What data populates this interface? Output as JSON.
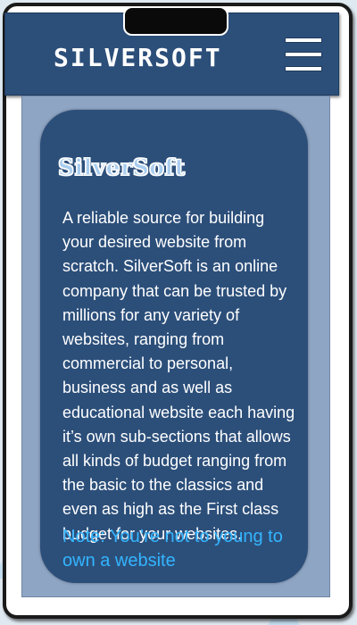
{
  "header": {
    "brand": "SILVERSOFT",
    "menu_icon": "hamburger-menu-icon"
  },
  "card": {
    "title": "SilverSoft",
    "body": "A reliable source for building your desired website from scratch. SilverSoft is an online company that can be trusted by millions for any variety of websites, ranging from commercial to personal, business and as well as educational website each having it’s own sub-sections that allows all kinds of budget ranging from the basic to the classics and even as high as the First class budget for your websites.",
    "note": "Note: You’re not to young to own a website"
  },
  "colors": {
    "header_bg": "#2c4f7a",
    "panel_bg": "#8ea5c4",
    "card_bg": "#2c4f7a",
    "note_text": "#33b5ff",
    "title_fill": "#aacdee"
  }
}
